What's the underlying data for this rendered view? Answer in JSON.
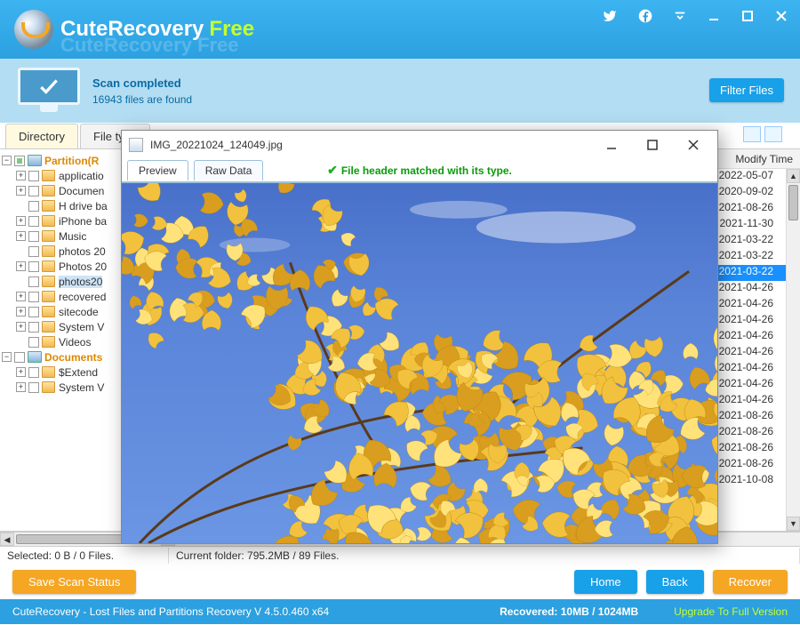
{
  "title_bar": {
    "app_name": "CuteRecovery",
    "free_label": "Free"
  },
  "scan": {
    "status": "Scan completed",
    "count_text": "16943 files are found",
    "filter": "Filter Files"
  },
  "tabs": {
    "directory": "Directory",
    "file_type": "File type"
  },
  "tree": {
    "root1": "Partition(R",
    "root2": "Documents",
    "items": [
      "applicatio",
      "Documen",
      "H drive ba",
      "iPhone ba",
      "Music",
      "photos 20",
      "Photos 20",
      "photos20",
      "recovered",
      "sitecode",
      "System V",
      "Videos"
    ],
    "items2": [
      "$Extend",
      "System V"
    ]
  },
  "columns": {
    "modify": "Modify Time"
  },
  "dates": [
    "2022-05-07",
    "2020-09-02",
    "2021-08-26",
    "2021-11-30",
    "2021-03-22",
    "2021-03-22",
    "2021-03-22",
    "2021-04-26",
    "2021-04-26",
    "2021-04-26",
    "2021-04-26",
    "2021-04-26",
    "2021-04-26",
    "2021-04-26",
    "2021-04-26",
    "2021-08-26",
    "2021-08-26",
    "2021-08-26",
    "2021-08-26",
    "2021-10-08"
  ],
  "status": {
    "selected": "Selected: 0 B / 0 Files.",
    "current": "Current folder: 795.2MB / 89 Files."
  },
  "buttons": {
    "save_scan": "Save Scan Status",
    "home": "Home",
    "back": "Back",
    "recover": "Recover"
  },
  "footer": {
    "app": "CuteRecovery - Lost Files and Partitions Recovery  V 4.5.0.460 x64",
    "recovered": "Recovered: 10MB / 1024MB",
    "upgrade": "Upgrade To Full Version"
  },
  "preview": {
    "filename": "IMG_20221024_124049.jpg",
    "tab_preview": "Preview",
    "tab_raw": "Raw Data",
    "status": "File header matched with its type."
  }
}
